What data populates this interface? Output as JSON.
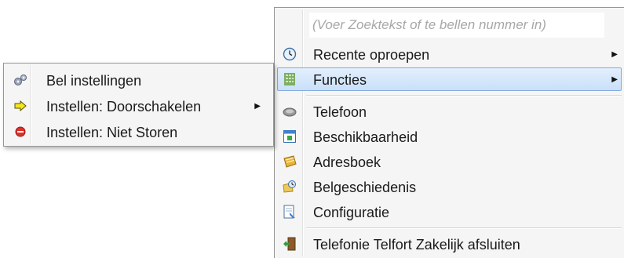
{
  "main_menu": {
    "search_placeholder": "(Voer Zoektekst of te bellen nummer in)",
    "items": [
      {
        "label": "Recente oproepen",
        "icon": "clock-icon",
        "submenu": true
      },
      {
        "label": "Functies",
        "icon": "grid-icon",
        "submenu": true,
        "highlighted": true
      },
      {
        "label": "Telefoon",
        "icon": "phone-icon"
      },
      {
        "label": "Beschikbaarheid",
        "icon": "availability-window-icon"
      },
      {
        "label": "Adresboek",
        "icon": "address-book-icon"
      },
      {
        "label": "Belgeschiedenis",
        "icon": "call-history-icon"
      },
      {
        "label": "Configuratie",
        "icon": "configuration-icon"
      },
      {
        "label": "Telefonie Telfort Zakelijk afsluiten",
        "icon": "exit-door-icon"
      }
    ]
  },
  "sub_menu": {
    "items": [
      {
        "label": "Bel instellingen",
        "icon": "gears-icon"
      },
      {
        "label": "Instellen: Doorschakelen",
        "icon": "forward-arrow-icon",
        "submenu": true
      },
      {
        "label": "Instellen: Niet Storen",
        "icon": "do-not-disturb-icon"
      }
    ]
  },
  "colors": {
    "highlight": "#c9e0fa",
    "highlight_border": "#84acdd",
    "menu_bg": "#f5f5f5",
    "dnd_red": "#e0302a",
    "forward_yellow": "#f5e61a"
  }
}
